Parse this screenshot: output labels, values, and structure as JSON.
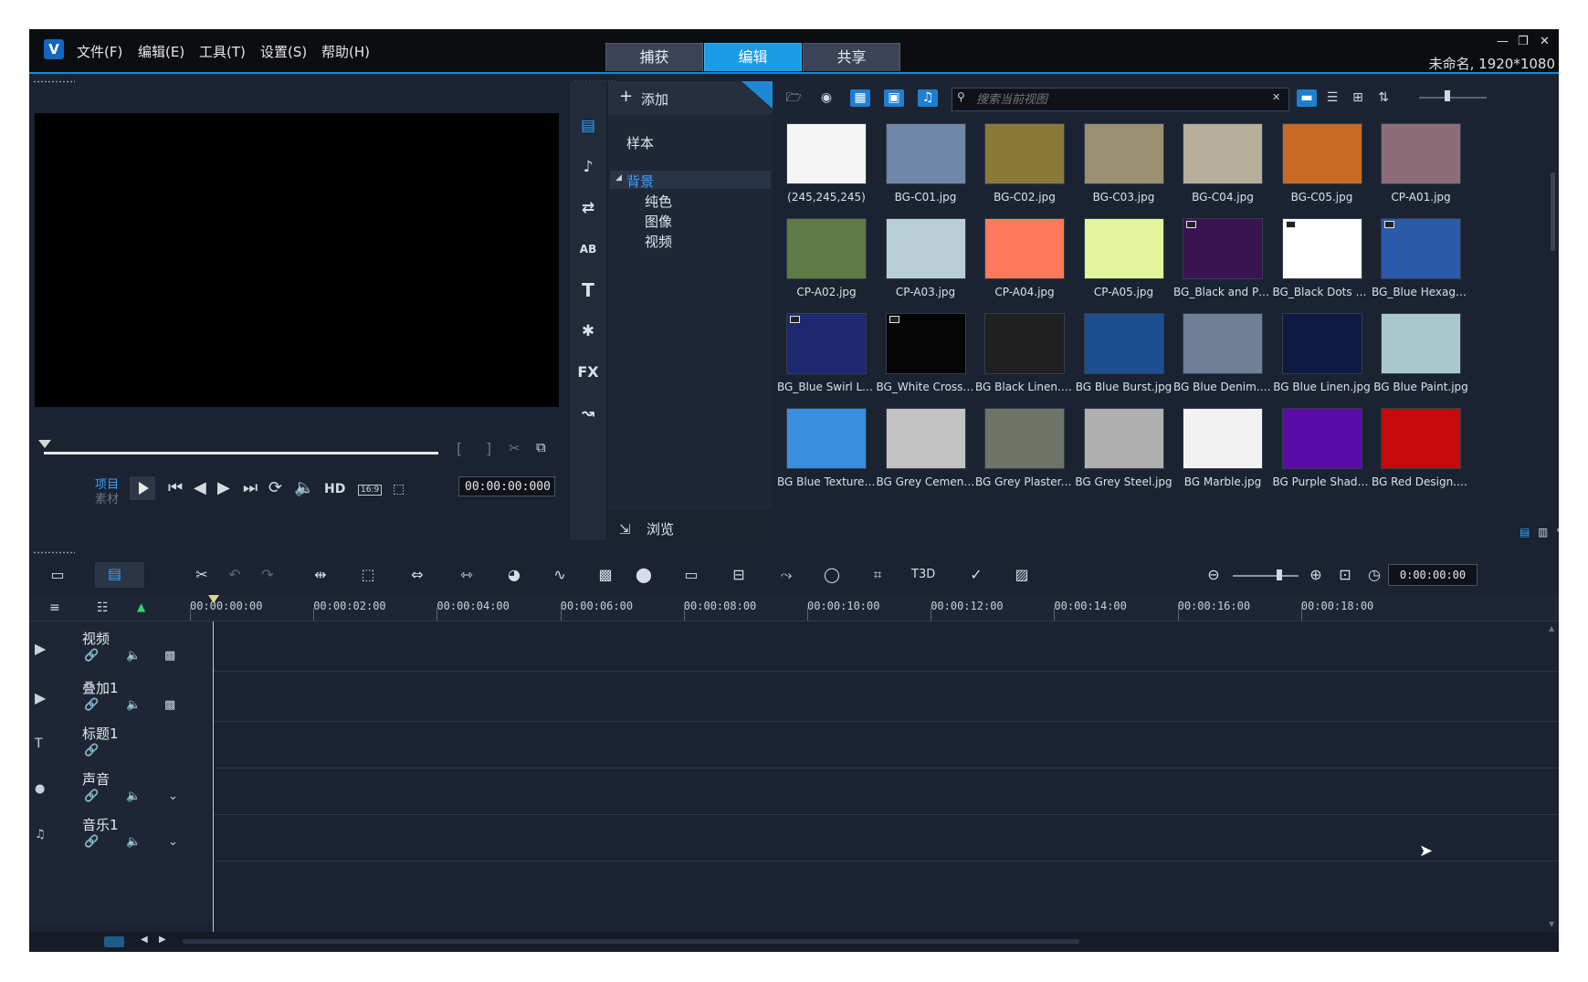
{
  "app": {
    "project_info": "未命名, 1920*1080",
    "menu": [
      "文件(F)",
      "编辑(E)",
      "工具(T)",
      "设置(S)",
      "帮助(H)"
    ],
    "workspace_tabs": [
      "捕获",
      "编辑",
      "共享"
    ],
    "active_tab": "编辑",
    "accent_color": "#1a9be6"
  },
  "player": {
    "mode_project": "项目",
    "mode_clip": "素材",
    "hd_label": "HD",
    "aspect_label": "16:9",
    "timecode": "00:00:00:000"
  },
  "library": {
    "add_label": "添加",
    "browse_label": "浏览",
    "search_placeholder": "搜索当前视图",
    "nav_icons": [
      "media-icon",
      "instant-project-icon",
      "transition-icon",
      "title-icon",
      "text-icon",
      "graphic-icon",
      "fx-icon",
      "path-icon"
    ],
    "nav_fx_label": "FX",
    "nav_title_label": "AB",
    "nav_text_label": "T",
    "tree": {
      "sample": "样本",
      "background": "背景",
      "solid": "纯色",
      "image": "图像",
      "video": "视频"
    },
    "items": [
      {
        "name": "(245,245,245)",
        "color": "#f5f5f5"
      },
      {
        "name": "BG-C01.jpg",
        "color": "#6f87a8"
      },
      {
        "name": "BG-C02.jpg",
        "color": "#8a7a3a"
      },
      {
        "name": "BG-C03.jpg",
        "color": "#9a8f70"
      },
      {
        "name": "BG-C04.jpg",
        "color": "#b8ae9c"
      },
      {
        "name": "BG-C05.jpg",
        "color": "#c86a24"
      },
      {
        "name": "CP-A01.jpg",
        "color": "#8d6e78"
      },
      {
        "name": "CP-A02.jpg",
        "color": "#5e7a46"
      },
      {
        "name": "CP-A03.jpg",
        "color": "#b8cfd6"
      },
      {
        "name": "CP-A04.jpg",
        "color": "#ff7a5a"
      },
      {
        "name": "CP-A05.jpg",
        "color": "#e2f59c"
      },
      {
        "name": "BG_Black and Purp...",
        "color": "#3a1452"
      },
      {
        "name": "BG_Black Dots Loo...",
        "color": "#ffffff"
      },
      {
        "name": "BG_Blue Hexagon ...",
        "color": "#2a5aa8"
      },
      {
        "name": "BG_Blue Swirl Loo...",
        "color": "#1c2870"
      },
      {
        "name": "BG_White Crosses ...",
        "color": "#050505"
      },
      {
        "name": "BG Black Linen.jpg",
        "color": "#202020"
      },
      {
        "name": "BG Blue Burst.jpg",
        "color": "#1c4e92"
      },
      {
        "name": "BG Blue Denim.jpg",
        "color": "#6e7f96"
      },
      {
        "name": "BG Blue Linen.jpg",
        "color": "#0e1a44"
      },
      {
        "name": "BG Blue Paint.jpg",
        "color": "#a8c8cc"
      },
      {
        "name": "BG Blue Texture.jpg",
        "color": "#3a8ee0"
      },
      {
        "name": "BG Grey Cement.jpg",
        "color": "#c2c2c2"
      },
      {
        "name": "BG Grey Plaster.jpg",
        "color": "#6e7468"
      },
      {
        "name": "BG Grey Steel.jpg",
        "color": "#b0b0b0"
      },
      {
        "name": "BG Marble.jpg",
        "color": "#f2f2f2"
      },
      {
        "name": "BG Purple Shadow...",
        "color": "#5a0ca8"
      },
      {
        "name": "BG Red Design.jpg",
        "color": "#c40a0a"
      }
    ],
    "video_badge_items": [
      11,
      12,
      13,
      14,
      15
    ]
  },
  "timeline": {
    "timecode": "0:00:00:00",
    "ruler": [
      "00:00:00:00",
      "00:00:02:00",
      "00:00:04:00",
      "00:00:06:00",
      "00:00:08:00",
      "00:00:10:00",
      "00:00:12:00",
      "00:00:14:00",
      "00:00:16:00",
      "00:00:18:00"
    ],
    "tracks": [
      {
        "name": "视频"
      },
      {
        "name": "叠加1"
      },
      {
        "name": "标题1"
      },
      {
        "name": "声音"
      },
      {
        "name": "音乐1"
      }
    ],
    "title_track_icon": "T",
    "text_3d_label": "T3D"
  }
}
